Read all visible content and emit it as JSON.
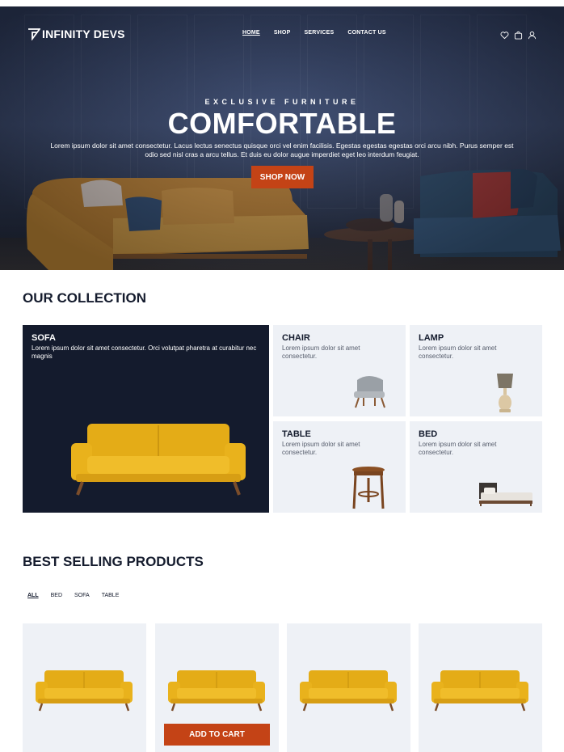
{
  "brand": {
    "name": "INFINITY DEVS",
    "accent": "#c44316",
    "dark": "#141b2d"
  },
  "nav": {
    "items": [
      "HOME",
      "SHOP",
      "SERVICES",
      "CONTACT US"
    ],
    "active": "HOME"
  },
  "header_icons": [
    "heart-icon",
    "bag-icon",
    "user-icon"
  ],
  "hero": {
    "eyebrow": "EXCLUSIVE FURNITURE",
    "title": "COMFORTABLE",
    "text": "Lorem ipsum dolor sit amet consectetur. Lacus lectus senectus quisque orci vel enim facilisis. Egestas egestas egestas orci arcu nibh. Purus semper est odio sed nisl cras a arcu tellus. Et duis eu dolor augue imperdiet eget leo interdum feugiat.",
    "button": "SHOP NOW"
  },
  "collection": {
    "title": "OUR COLLECTION",
    "items": [
      {
        "name": "SOFA",
        "text": "Lorem ipsum dolor sit amet consectetur. Orci volutpat pharetra at curabitur nec magnis"
      },
      {
        "name": "CHAIR",
        "text": "Lorem ipsum dolor sit amet consectetur."
      },
      {
        "name": "LAMP",
        "text": "Lorem ipsum dolor sit amet consectetur."
      },
      {
        "name": "TABLE",
        "text": "Lorem ipsum dolor sit amet consectetur."
      },
      {
        "name": "BED",
        "text": "Lorem ipsum dolor sit amet consectetur."
      }
    ]
  },
  "best_selling": {
    "title": "BEST SELLING PRODUCTS",
    "filters": [
      "ALL",
      "BED",
      "SOFA",
      "TABLE"
    ],
    "active_filter": "ALL",
    "cart_button": "ADD TO CART"
  }
}
